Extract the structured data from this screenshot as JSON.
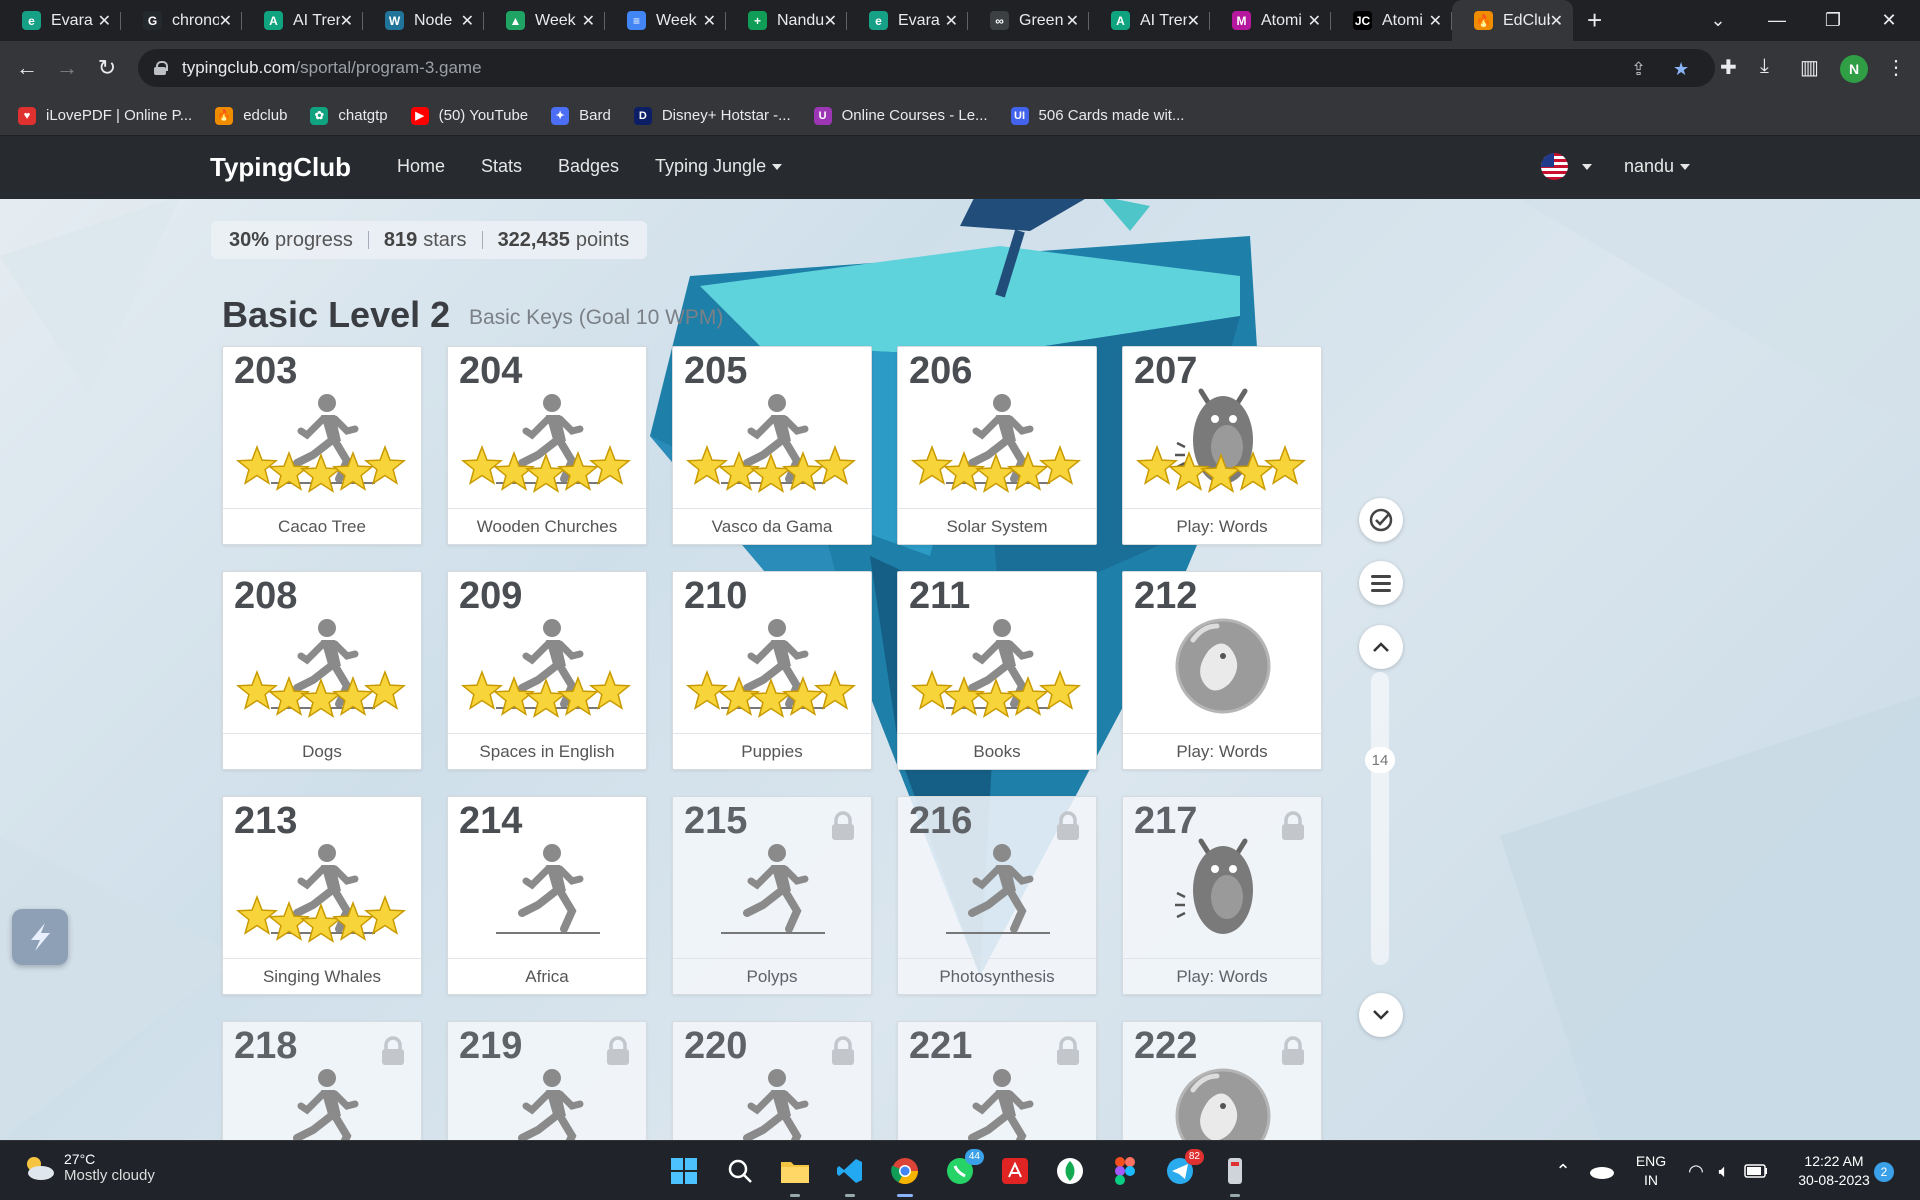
{
  "browser": {
    "tabs": [
      {
        "title": "Evara",
        "color": "#16a085",
        "glyph": "e"
      },
      {
        "title": "chrono",
        "color": "#24292e",
        "glyph": "G"
      },
      {
        "title": "AI Tren",
        "color": "#10a37f",
        "glyph": "A"
      },
      {
        "title": "Node",
        "color": "#21759b",
        "glyph": "W"
      },
      {
        "title": "Week",
        "color": "#1fa463",
        "glyph": "▲"
      },
      {
        "title": "Week",
        "color": "#4285f4",
        "glyph": "≡"
      },
      {
        "title": "Nandu",
        "color": "#0f9d58",
        "glyph": "+"
      },
      {
        "title": "Evara",
        "color": "#16a085",
        "glyph": "e"
      },
      {
        "title": "Green",
        "color": "#3c4043",
        "glyph": "∞"
      },
      {
        "title": "AI Tren",
        "color": "#10a37f",
        "glyph": "A"
      },
      {
        "title": "Atomi",
        "color": "#b5179e",
        "glyph": "M"
      },
      {
        "title": "Atomi",
        "color": "#000000",
        "glyph": "JC"
      },
      {
        "title": "EdClub",
        "color": "#f08c00",
        "glyph": "🔥"
      }
    ],
    "url_host": "typingclub.com",
    "url_path": "/sportal/program-3.game",
    "profile_initial": "N",
    "bookmarks": [
      {
        "label": "iLovePDF | Online P...",
        "color": "#e03131",
        "glyph": "♥"
      },
      {
        "label": "edclub",
        "color": "#f08c00",
        "glyph": "🔥"
      },
      {
        "label": "chatgtp",
        "color": "#10a37f",
        "glyph": "✿"
      },
      {
        "label": "(50) YouTube",
        "color": "#ff0000",
        "glyph": "▶"
      },
      {
        "label": "Bard",
        "color": "#4c6ef5",
        "glyph": "✦"
      },
      {
        "label": "Disney+ Hotstar -...",
        "color": "#0b1e66",
        "glyph": "D"
      },
      {
        "label": "Online Courses - Le...",
        "color": "#9c36b5",
        "glyph": "U"
      },
      {
        "label": "506 Cards made wit...",
        "color": "#4263eb",
        "glyph": "UI"
      }
    ]
  },
  "app": {
    "brand": "TypingClub",
    "nav": [
      "Home",
      "Stats",
      "Badges",
      "Typing Jungle"
    ],
    "user": "nandu",
    "progress": {
      "percent": "30%",
      "percent_label": "progress",
      "stars": "819",
      "stars_label": "stars",
      "points": "322,435",
      "points_label": "points"
    },
    "level_title": "Basic Level 2",
    "level_subtitle": "Basic Keys (Goal 10 WPM)",
    "scroll_page": "14",
    "lessons": [
      {
        "num": "203",
        "label": "Cacao Tree",
        "kind": "run",
        "stars": 5,
        "locked": false
      },
      {
        "num": "204",
        "label": "Wooden Churches",
        "kind": "run",
        "stars": 5,
        "locked": false
      },
      {
        "num": "205",
        "label": "Vasco da Gama",
        "kind": "run",
        "stars": 5,
        "locked": false
      },
      {
        "num": "206",
        "label": "Solar System",
        "kind": "run",
        "stars": 5,
        "locked": false
      },
      {
        "num": "207",
        "label": "Play: Words",
        "kind": "monster",
        "stars": 5,
        "locked": false
      },
      {
        "num": "208",
        "label": "Dogs",
        "kind": "run",
        "stars": 5,
        "locked": false
      },
      {
        "num": "209",
        "label": "Spaces in English",
        "kind": "run",
        "stars": 5,
        "locked": false
      },
      {
        "num": "210",
        "label": "Puppies",
        "kind": "run",
        "stars": 5,
        "locked": false
      },
      {
        "num": "211",
        "label": "Books",
        "kind": "run",
        "stars": 5,
        "locked": false
      },
      {
        "num": "212",
        "label": "Play: Words",
        "kind": "bubble",
        "stars": 0,
        "locked": false
      },
      {
        "num": "213",
        "label": "Singing Whales",
        "kind": "run",
        "stars": 5,
        "locked": false
      },
      {
        "num": "214",
        "label": "Africa",
        "kind": "run",
        "stars": 0,
        "locked": false
      },
      {
        "num": "215",
        "label": "Polyps",
        "kind": "run",
        "stars": 0,
        "locked": true
      },
      {
        "num": "216",
        "label": "Photosynthesis",
        "kind": "run",
        "stars": 0,
        "locked": true
      },
      {
        "num": "217",
        "label": "Play: Words",
        "kind": "monster",
        "stars": 0,
        "locked": true
      },
      {
        "num": "218",
        "label": "",
        "kind": "run",
        "stars": 0,
        "locked": true
      },
      {
        "num": "219",
        "label": "",
        "kind": "run",
        "stars": 0,
        "locked": true
      },
      {
        "num": "220",
        "label": "",
        "kind": "run",
        "stars": 0,
        "locked": true
      },
      {
        "num": "221",
        "label": "",
        "kind": "run",
        "stars": 0,
        "locked": true
      },
      {
        "num": "222",
        "label": "",
        "kind": "bubble",
        "stars": 0,
        "locked": true
      }
    ]
  },
  "taskbar": {
    "temperature": "27°C",
    "weather": "Mostly cloudy",
    "lang_line1": "ENG",
    "lang_line2": "IN",
    "time": "12:22 AM",
    "date": "30-08-2023",
    "notifications": "2",
    "badges": {
      "whatsapp": "44",
      "telegram": "82"
    }
  }
}
